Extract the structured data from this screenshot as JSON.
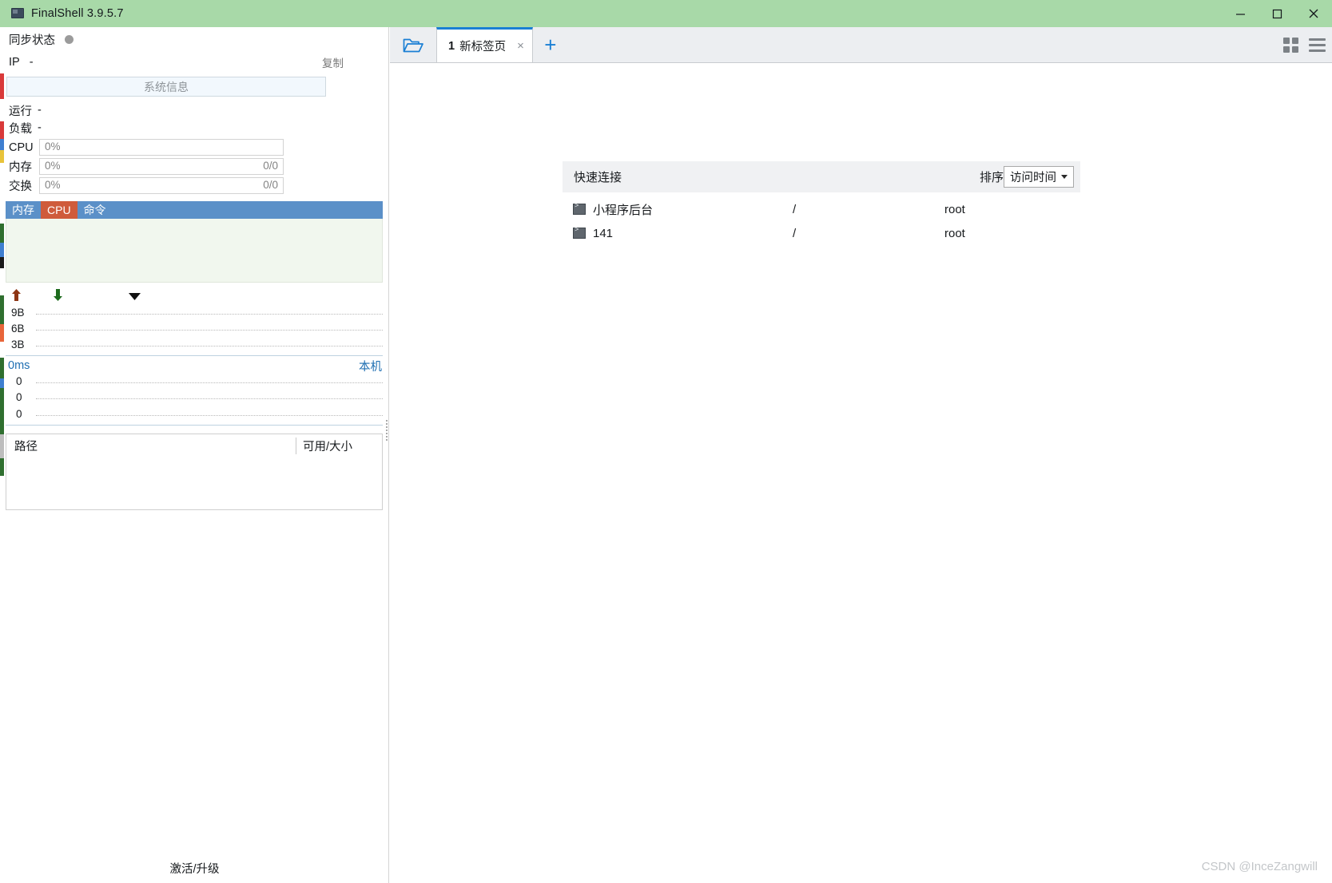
{
  "window": {
    "title": "FinalShell 3.9.5.7",
    "app_icon": "monitor-icon",
    "minimize": "minimize-button",
    "maximize": "maximize-button",
    "close": "close-button"
  },
  "sidebar": {
    "sync": {
      "label": "同步状态",
      "status_color": "#9b9b9b"
    },
    "ip": {
      "label": "IP",
      "value": "-",
      "copy_label": "复制"
    },
    "system_info_button": "系统信息",
    "uptime": {
      "label": "运行",
      "value": "-"
    },
    "load": {
      "label": "负载",
      "value": "-"
    },
    "meters": [
      {
        "label": "CPU",
        "percent": "0%",
        "detail": ""
      },
      {
        "label": "内存",
        "percent": "0%",
        "detail": "0/0"
      },
      {
        "label": "交换",
        "percent": "0%",
        "detail": "0/0"
      }
    ],
    "process_table": {
      "columns": [
        {
          "label": "内存",
          "active": false
        },
        {
          "label": "CPU",
          "active": true
        },
        {
          "label": "命令",
          "active": false
        }
      ],
      "rows": []
    },
    "network": {
      "upload_icon": "arrow-up-icon",
      "download_icon": "arrow-down-icon",
      "dropdown_icon": "caret-down-icon",
      "y_labels": [
        "9B",
        "6B",
        "3B"
      ]
    },
    "ping": {
      "value": "0ms",
      "host_label": "本机",
      "y_labels": [
        "0",
        "0",
        "0"
      ]
    },
    "disks": {
      "col_path": "路径",
      "col_size": "可用/大小",
      "rows": []
    },
    "activate_link": "激活/升级"
  },
  "main": {
    "tabbar": {
      "folder_icon": "open-folder-icon",
      "tabs": [
        {
          "number": "1",
          "label": "新标签页",
          "close": "×",
          "active": true
        }
      ],
      "add_tab": "+",
      "grid_icon": "grid-view-icon",
      "menu_icon": "hamburger-menu-icon"
    },
    "quick_connect": {
      "title": "快速连接",
      "sort_label": "排序",
      "sort_value": "访问时间",
      "rows": [
        {
          "icon": "terminal-icon",
          "name": "小程序后台",
          "path": "/",
          "user": "root"
        },
        {
          "icon": "terminal-icon",
          "name": "141",
          "path": "/",
          "user": "root"
        }
      ]
    }
  },
  "watermark": "CSDN @InceZangwill",
  "colors": {
    "titlebar": "#a8d9a8",
    "accent_blue": "#1a7fd4",
    "table_header": "#5b90c8",
    "table_header_active": "#cf5b3b"
  }
}
